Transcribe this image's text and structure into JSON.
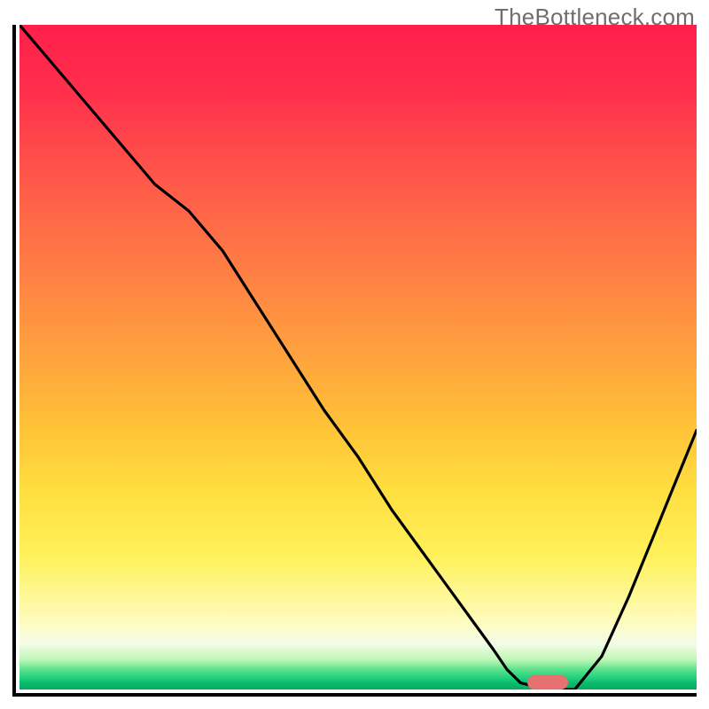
{
  "watermark": "TheBottleneck.com",
  "colors": {
    "axis": "#000000",
    "curve": "#000000",
    "marker": "#e77171",
    "gradient_stops_top_to_bottom": [
      "#ff1f4a",
      "#ff5a49",
      "#ff8144",
      "#ffa33d",
      "#ffc137",
      "#ffde3f",
      "#fff15a",
      "#fdfcc0",
      "#bff7b7",
      "#5ce28c",
      "#1fd07d",
      "#0cba6d",
      "#07aa60"
    ]
  },
  "chart_data": {
    "type": "line",
    "title": "",
    "xlabel": "",
    "ylabel": "",
    "xlim": [
      0,
      100
    ],
    "ylim": [
      0,
      100
    ],
    "grid": false,
    "legend": null,
    "series": [
      {
        "name": "bottleneck-curve",
        "x": [
          0,
          5,
          10,
          15,
          20,
          25,
          30,
          35,
          40,
          45,
          50,
          55,
          60,
          65,
          70,
          72,
          74,
          78,
          82,
          86,
          90,
          94,
          98,
          100
        ],
        "values": [
          100,
          94,
          88,
          82,
          76,
          72,
          66,
          58,
          50,
          42,
          35,
          27,
          20,
          13,
          6,
          3,
          1,
          0,
          0,
          5,
          14,
          24,
          34,
          39
        ]
      }
    ],
    "marker": {
      "name": "bottleneck-marker",
      "x_center": 78,
      "y": 0,
      "width_x_units": 6
    },
    "axes_visible": {
      "left": true,
      "bottom": true,
      "right": false,
      "top": false
    },
    "tick_labels": []
  }
}
